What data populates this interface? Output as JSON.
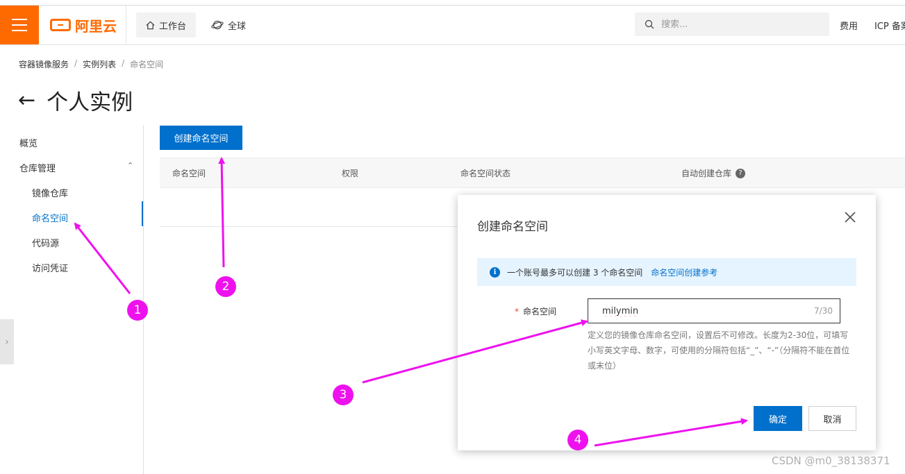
{
  "topbar": {
    "logo_text": "阿里云",
    "nav_workbench": "工作台",
    "nav_global": "全球",
    "search_placeholder": "搜索...",
    "link_fees": "费用",
    "link_icp": "ICP 备案"
  },
  "breadcrumb": [
    "容器镜像服务",
    "实例列表",
    "命名空间"
  ],
  "page_title": "个人实例",
  "sidebar": {
    "overview": "概览",
    "repo_management": "仓库管理",
    "items": [
      "镜像仓库",
      "命名空间",
      "代码源",
      "访问凭证"
    ]
  },
  "main": {
    "create_button": "创建命名空间",
    "columns": [
      "命名空间",
      "权限",
      "命名空间状态",
      "自动创建仓库"
    ]
  },
  "modal": {
    "title": "创建命名空间",
    "info_text": "一个账号最多可以创建 3 个命名空间",
    "info_link": "命名空间创建参考",
    "field_label": "命名空间",
    "field_value": "milymin",
    "field_count": "7/30",
    "help_text": "定义您的镜像仓库命名空间，设置后不可修改。长度为2-30位，可填写小写英文字母、数字，可使用的分隔符包括“_”、“-”（分隔符不能在首位或末位）",
    "ok_button": "确定",
    "cancel_button": "取消"
  },
  "annotations": [
    "1",
    "2",
    "3",
    "4"
  ],
  "watermark": "CSDN @m0_38138371",
  "colors": {
    "brand": "#ff6a00",
    "primary": "#0070cc",
    "annotation": "#ee11ee"
  }
}
